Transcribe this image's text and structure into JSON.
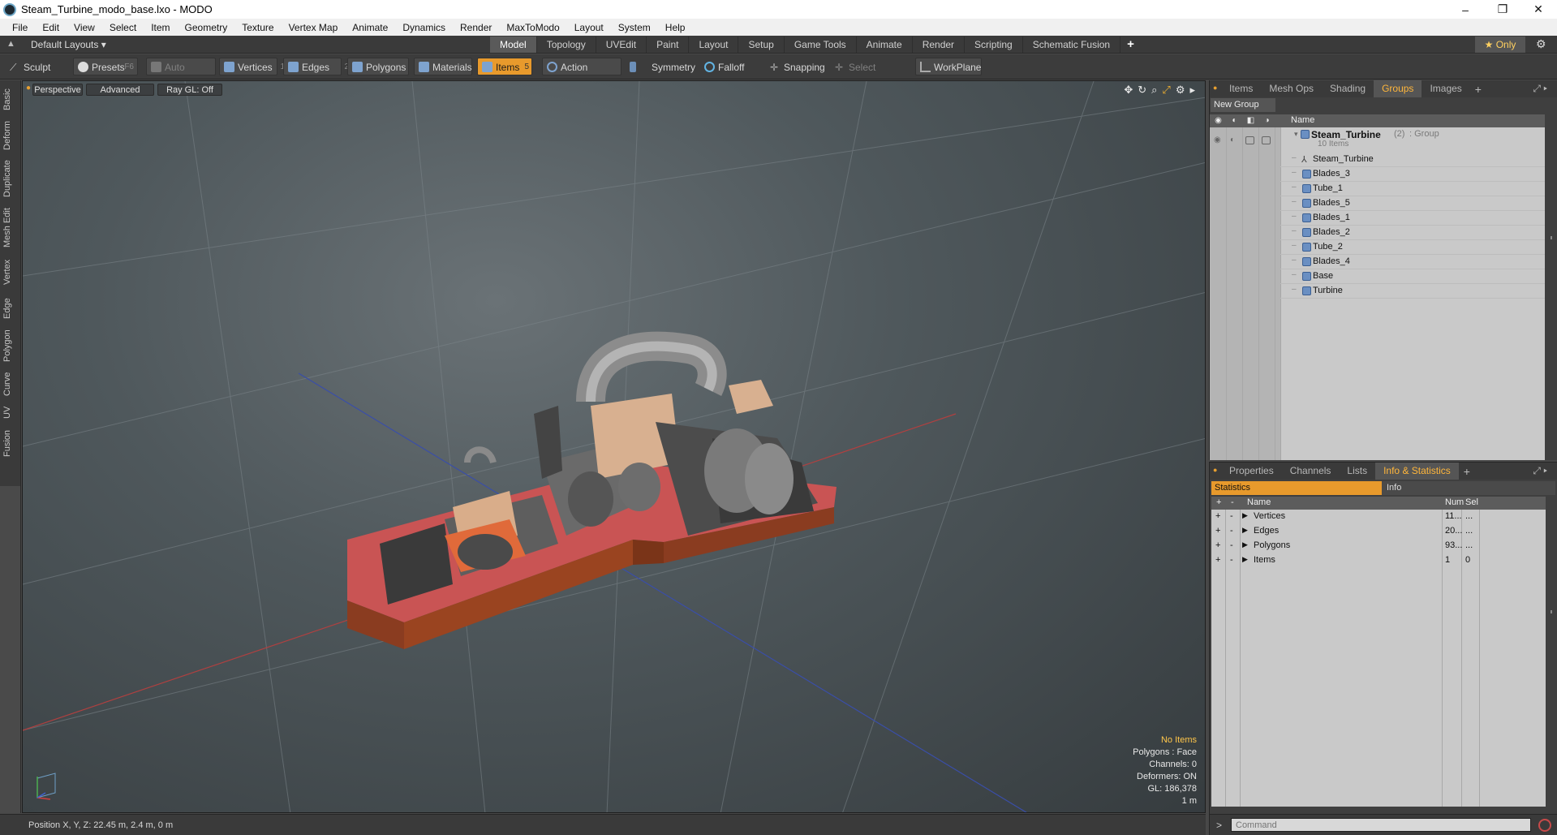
{
  "window": {
    "title": "Steam_Turbine_modo_base.lxo - MODO",
    "controls": [
      "–",
      "❐",
      "✕"
    ]
  },
  "menu": [
    "File",
    "Edit",
    "View",
    "Select",
    "Item",
    "Geometry",
    "Texture",
    "Vertex Map",
    "Animate",
    "Dynamics",
    "Render",
    "MaxToModo",
    "Layout",
    "System",
    "Help"
  ],
  "layout_bar": {
    "layout_selector": "Default Layouts ▾",
    "tabs": [
      "Model",
      "Topology",
      "UVEdit",
      "Paint",
      "Layout",
      "Setup",
      "Game Tools",
      "Animate",
      "Render",
      "Scripting",
      "Schematic Fusion"
    ],
    "active_tab": "Model",
    "add_tab": "+",
    "only_label": "★  Only"
  },
  "toolbar": {
    "sculpt": "Sculpt",
    "presets": "Presets",
    "presets_key": "F6",
    "auto_select": "Auto Select",
    "vertices": "Vertices",
    "vertices_count": "1",
    "edges": "Edges",
    "edges_count": "2",
    "polygons": "Polygons",
    "materials": "Materials",
    "items": "Items",
    "items_count": "5",
    "action_center": "Action Center",
    "symmetry": "Symmetry",
    "falloff": "Falloff",
    "snapping": "Snapping",
    "select_through": "Select Through",
    "workplane": "WorkPlane"
  },
  "left_tools": [
    "Basic",
    "Deform",
    "Duplicate",
    "Mesh Edit",
    "Vertex",
    "Edge",
    "Polygon",
    "Curve",
    "UV",
    "Fusion"
  ],
  "viewport": {
    "view_mode": "Perspective",
    "shading": "Advanced",
    "raygl": "Ray GL: Off",
    "info": {
      "no_items": "No Items",
      "polygons": "Polygons : Face",
      "channels": "Channels: 0",
      "deformers": "Deformers: ON",
      "gl": "GL: 186,378",
      "scale": "1 m"
    }
  },
  "status_bar": {
    "position": "Position X, Y, Z:   22.45 m, 2.4 m, 0 m"
  },
  "groups_panel": {
    "tabs": [
      "Items",
      "Mesh Ops",
      "Shading",
      "Groups",
      "Images"
    ],
    "active_tab": "Groups",
    "new_group": "New Group",
    "name_header": "Name",
    "group_name": "Steam_Turbine",
    "group_count": "(2)",
    "group_type": ": Group",
    "group_subtitle": "10 Items",
    "items": [
      "Steam_Turbine",
      "Blades_3",
      "Tube_1",
      "Blades_5",
      "Blades_1",
      "Blades_2",
      "Tube_2",
      "Blades_4",
      "Base",
      "Turbine"
    ]
  },
  "stats_panel": {
    "tabs": [
      "Properties",
      "Channels",
      "Lists",
      "Info & Statistics"
    ],
    "active_tab": "Info & Statistics",
    "sub_tabs": [
      "Statistics",
      "Info"
    ],
    "headers": {
      "name": "Name",
      "num": "Num",
      "sel": "Sel"
    },
    "rows": [
      {
        "name": "Vertices",
        "num": "11...",
        "sel": "..."
      },
      {
        "name": "Edges",
        "num": "20...",
        "sel": "..."
      },
      {
        "name": "Polygons",
        "num": "93...",
        "sel": "..."
      },
      {
        "name": "Items",
        "num": "1",
        "sel": "0"
      }
    ]
  },
  "command_bar": {
    "prompt": ">",
    "placeholder": "Command"
  }
}
